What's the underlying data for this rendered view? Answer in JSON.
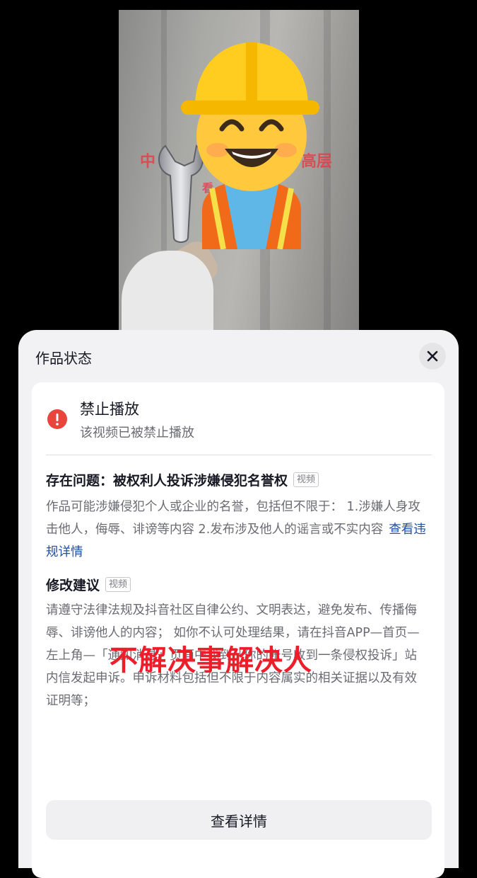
{
  "video": {
    "overlay_text_1": "中",
    "overlay_text_2": "高层",
    "overlay_text_3": "看",
    "wrench_icon": "wrench-icon",
    "worker_icon": "construction-worker-emoji"
  },
  "sheet": {
    "title": "作品状态",
    "close_icon": "close-icon"
  },
  "status": {
    "icon": "warning-circle-icon",
    "title": "禁止播放",
    "subtitle": "该视频已被禁止播放"
  },
  "issue": {
    "title": "存在问题：被权利人投诉涉嫌侵犯名誉权",
    "tag": "视频",
    "body": "作品可能涉嫌侵犯个人或企业的名誉，包括但不限于： 1.涉嫌人身攻击他人，侮辱、诽谤等内容 2.发布涉及他人的谣言或不实内容",
    "link": "查看违规详情"
  },
  "suggestion": {
    "title": "修改建议",
    "tag": "视频",
    "body": "请遵守法律法规及抖音社区自律公约、文明表达，避免发布、传播侮辱、诽谤他人的内容； 如你不认可处理结果，请在抖音APP—首页—左上角—「通知消息」页面中找到「你的账号收到一条侵权投诉」站内信发起申诉。申诉材料包括但不限于内容属实的相关证据以及有效证明等；"
  },
  "watermark": "不解决事解决人",
  "button": {
    "label": "查看详情"
  },
  "colors": {
    "danger": "#e8453c",
    "link": "#1f4fa3",
    "watermark": "#ee1d2a"
  }
}
